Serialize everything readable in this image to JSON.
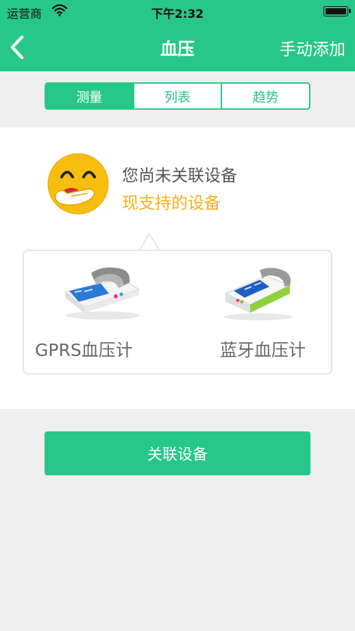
{
  "status_bar": {
    "carrier": "运营商",
    "time": "下午2:32"
  },
  "nav": {
    "title": "血压",
    "right_action": "手动添加"
  },
  "tabs": [
    {
      "label": "测量"
    },
    {
      "label": "列表"
    },
    {
      "label": "趋势"
    }
  ],
  "message": {
    "line1": "您尚未关联设备",
    "line2": "现支持的设备"
  },
  "devices": [
    {
      "label": "GPRS血压计"
    },
    {
      "label": "蓝牙血压计"
    }
  ],
  "actions": {
    "link_device": "关联设备"
  },
  "colors": {
    "primary": "#27c789",
    "accent": "#f3b11a",
    "background": "#efefef"
  }
}
